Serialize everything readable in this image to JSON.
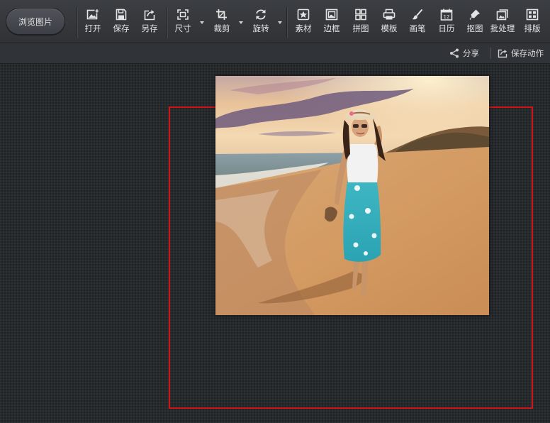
{
  "toolbar": {
    "browse_label": "浏览图片",
    "tools": [
      {
        "id": "open",
        "label": "打开",
        "icon": "open-image-icon"
      },
      {
        "id": "save",
        "label": "保存",
        "icon": "save-icon"
      },
      {
        "id": "save-as",
        "label": "另存",
        "icon": "save-as-icon"
      },
      {
        "id": "size",
        "label": "尺寸",
        "icon": "resize-icon",
        "dropdown": true
      },
      {
        "id": "crop",
        "label": "裁剪",
        "icon": "crop-icon",
        "dropdown": true
      },
      {
        "id": "rotate",
        "label": "旋转",
        "icon": "rotate-icon",
        "dropdown": true
      },
      {
        "id": "material",
        "label": "素材",
        "icon": "star-stamp-icon"
      },
      {
        "id": "border",
        "label": "边框",
        "icon": "frame-icon"
      },
      {
        "id": "collage",
        "label": "拼图",
        "icon": "collage-grid-icon"
      },
      {
        "id": "template",
        "label": "模板",
        "icon": "template-icon"
      },
      {
        "id": "brush",
        "label": "画笔",
        "icon": "brush-icon"
      },
      {
        "id": "calendar",
        "label": "日历",
        "icon": "calendar-icon"
      },
      {
        "id": "cutout",
        "label": "抠图",
        "icon": "pen-cutout-icon"
      },
      {
        "id": "batch",
        "label": "批处理",
        "icon": "batch-process-icon"
      },
      {
        "id": "layout",
        "label": "排版",
        "icon": "layout-icon"
      }
    ]
  },
  "subbar": {
    "share_label": "分享",
    "save_action_label": "保存动作"
  },
  "calendar_icon_number": "12",
  "colors": {
    "toolbar_bg": "#35383c",
    "canvas_bg": "#262a2d",
    "highlight": "#d0141a"
  }
}
